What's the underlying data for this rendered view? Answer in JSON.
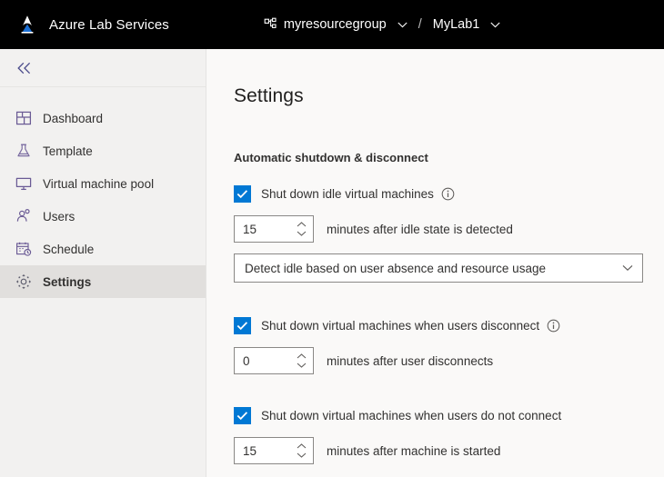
{
  "topbar": {
    "logo_icon": "azure-logo-icon",
    "brand_title": "Azure Lab Services",
    "breadcrumb": {
      "resource_group_icon": "resource-group-icon",
      "resource_group": "myresourcegroup",
      "separator": "/",
      "lab_name": "MyLab1",
      "caret_icon": "chevron-down-icon"
    },
    "background_color": "#000000"
  },
  "sidebar": {
    "collapse_icon": "chevron-double-left-icon",
    "background_color": "#f2f1f0",
    "selected_background_color": "#e1dfdd",
    "items": [
      {
        "label": "Dashboard",
        "icon": "dashboard-grid-icon",
        "selected": false
      },
      {
        "label": "Template",
        "icon": "flask-icon",
        "selected": false
      },
      {
        "label": "Virtual machine pool",
        "icon": "monitor-icon",
        "selected": false
      },
      {
        "label": "Users",
        "icon": "user-icon",
        "selected": false
      },
      {
        "label": "Schedule",
        "icon": "calendar-clock-icon",
        "selected": false
      },
      {
        "label": "Settings",
        "icon": "gear-icon",
        "selected": true
      }
    ]
  },
  "main": {
    "page_title": "Settings",
    "section_title": "Automatic shutdown & disconnect",
    "accent_color": "#0078d4",
    "groups": [
      {
        "checkbox_label": "Shut down idle virtual machines",
        "checked": true,
        "has_info_icon": true,
        "info_icon": "info-circle-icon",
        "input_value": "15",
        "input_suffix": "minutes after idle state is detected",
        "dropdown_value": "Detect idle based on user absence and resource usage",
        "dropdown_caret_icon": "chevron-down-icon"
      },
      {
        "checkbox_label": "Shut down virtual machines when users disconnect",
        "checked": true,
        "has_info_icon": true,
        "info_icon": "info-circle-icon",
        "input_value": "0",
        "input_suffix": "minutes after user disconnects"
      },
      {
        "checkbox_label": "Shut down virtual machines when users do not connect",
        "checked": true,
        "has_info_icon": false,
        "input_value": "15",
        "input_suffix": "minutes after machine is started"
      }
    ]
  }
}
